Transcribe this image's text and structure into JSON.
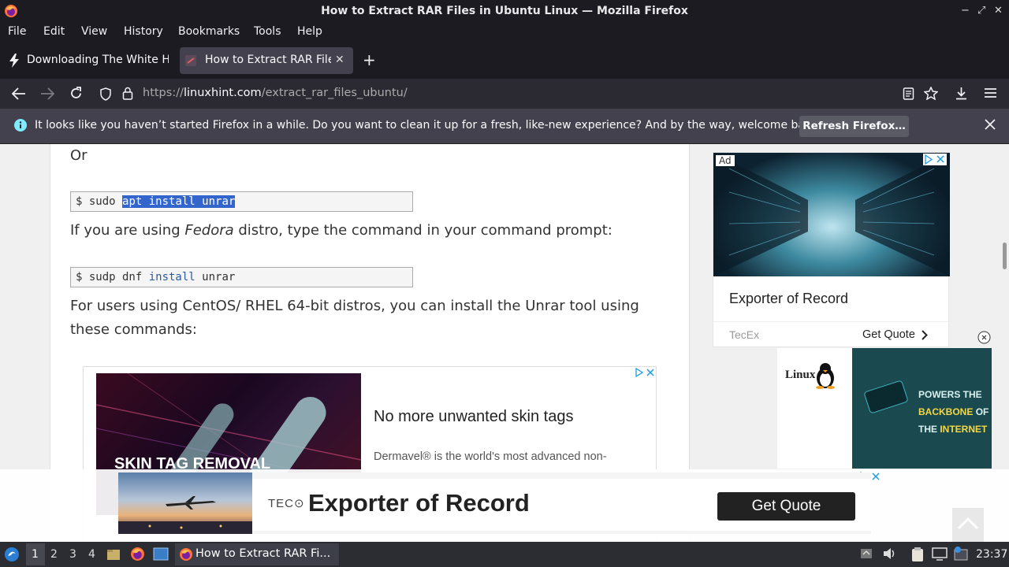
{
  "window": {
    "title": "How to Extract RAR Files in Ubuntu Linux — Mozilla Firefox",
    "controls": [
      "−",
      "⤢",
      "✕"
    ]
  },
  "menu": [
    "File",
    "Edit",
    "View",
    "History",
    "Bookmarks",
    "Tools",
    "Help"
  ],
  "tabs": [
    {
      "label": "Downloading The White House",
      "active": false
    },
    {
      "label": "How to Extract RAR Files",
      "active": true
    }
  ],
  "url": {
    "prefix": "https://",
    "domain": "linuxhint.com",
    "path": "/extract_rar_files_ubuntu/"
  },
  "notification": {
    "message": "It looks like you haven’t started Firefox in a while. Do you want to clean it up for a fresh, like-new experience? And by the way, welcome back!",
    "button": "Refresh Firefox…"
  },
  "article": {
    "or_text": "Or",
    "code1": {
      "prompt": "$ sudo ",
      "selected": "apt install unrar"
    },
    "fedora_line": {
      "before": "If you are using ",
      "emph": "Fedora",
      "after": " distro, type the command in your command prompt:"
    },
    "code2": {
      "prompt": "$ sudp dnf ",
      "keyword": "install",
      "after": " unrar"
    },
    "centos_line1": "For users using CentOS/ RHEL 64-bit distros, you can install the Unrar tool using",
    "centos_line2": "these commands:"
  },
  "inline_ad": {
    "image_text": "SKIN TAG REMOVAL",
    "headline": "No more unwanted skin tags",
    "body": "Dermavel® is the world's most advanced non-"
  },
  "sidebar_ad": {
    "badge": "Ad",
    "title": "Exporter of Record",
    "brand": "TecEx",
    "cta": "Get Quote"
  },
  "linux_ad": {
    "logo": "Linux",
    "line1": "POWERS THE",
    "line2": "BACKBONE",
    "line2b": "OF",
    "line3": "THE",
    "line3b": "INTERNET"
  },
  "bottom_ad": {
    "logo": "TEC",
    "title": "Exporter of Record",
    "cta": "Get Quote"
  },
  "taskbar": {
    "workspaces": [
      "1",
      "2",
      "3",
      "4"
    ],
    "active_workspace": "1",
    "task_label": "How to Extract RAR Fi...",
    "clock": "23:37"
  }
}
